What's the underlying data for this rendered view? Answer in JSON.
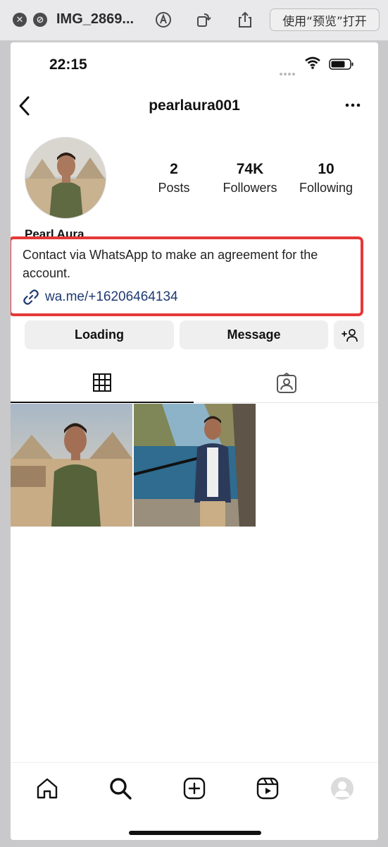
{
  "titlebar": {
    "title": "IMG_2869...",
    "open_button_label": "使用“预览”打开"
  },
  "status_bar": {
    "time": "22:15"
  },
  "profile": {
    "username": "pearlaura001",
    "display_name": "Pearl Aura",
    "stats": [
      {
        "value": "2",
        "label": "Posts"
      },
      {
        "value": "74K",
        "label": "Followers"
      },
      {
        "value": "10",
        "label": "Following"
      }
    ],
    "bio": "Contact via WhatsApp to make an agreement for the account.",
    "link": "wa.me/+16206464134",
    "highlight_color": "#e53838"
  },
  "buttons": {
    "loading_label": "Loading",
    "message_label": "Message",
    "add_friend_label": "+"
  },
  "colors": {
    "link": "#1e3a70",
    "button_bg": "#efefef"
  }
}
